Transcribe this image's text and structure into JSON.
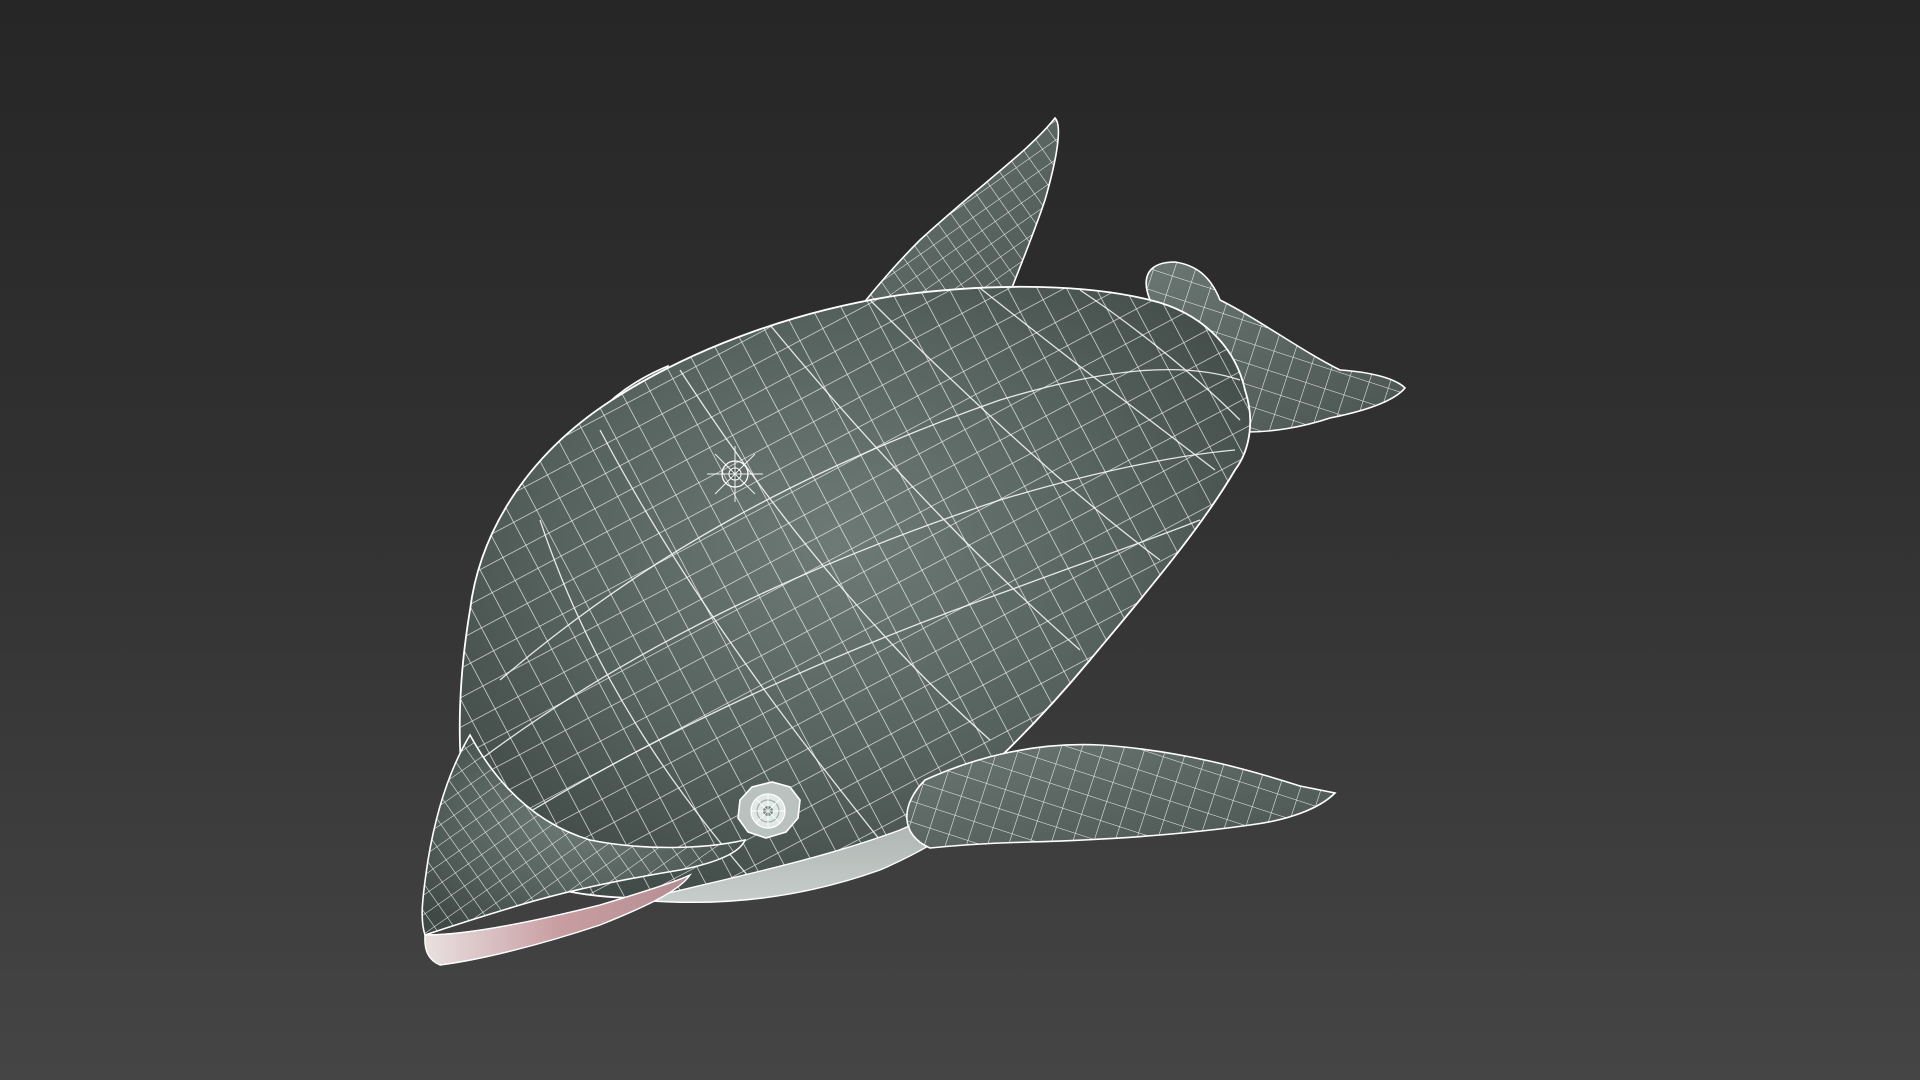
{
  "viewport": {
    "background_top": "#262626",
    "background_bottom": "#454545"
  },
  "model": {
    "subject": "dolphin",
    "display_mode": "shaded-with-wireframe",
    "colors": {
      "body": "#57645f",
      "body_light": "#7f8b86",
      "belly": "#a9b1ad",
      "shadow": "#3d4744",
      "wire": "#ffffff",
      "mouth": "#c9a3a6",
      "eye": "#dfe6e4"
    },
    "parts": [
      "body",
      "dorsal-fin",
      "tail-fluke",
      "left-pectoral-fin",
      "right-pectoral-fin",
      "head",
      "mouth",
      "eye",
      "blowhole"
    ]
  }
}
